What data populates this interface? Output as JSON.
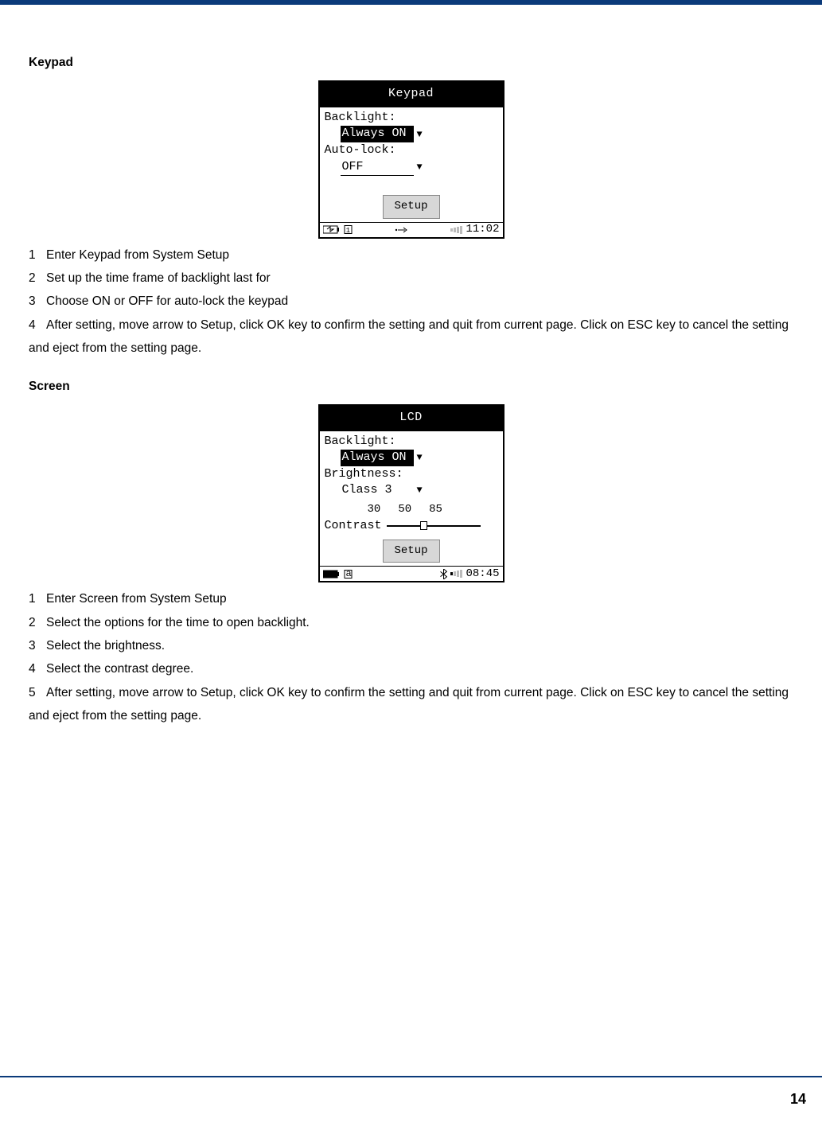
{
  "page": {
    "number": "14"
  },
  "section1": {
    "heading": "Keypad",
    "figure": {
      "title": "Keypad",
      "backlight_label": "Backlight:",
      "backlight_value": "Always ON",
      "autolock_label": "Auto-lock:",
      "autolock_value": "OFF",
      "setup_label": "Setup",
      "status": {
        "time": "11:02"
      }
    },
    "steps": [
      "Enter Keypad from System Setup",
      "Set up the time frame of backlight last for",
      "Choose ON or OFF for auto-lock the keypad",
      "After setting, move arrow to Setup, click OK key to confirm the setting and quit from current page. Click on ESC key to cancel the setting and eject from the setting page."
    ],
    "step_nums": [
      "1",
      "2",
      "3",
      "4"
    ]
  },
  "section2": {
    "heading": "Screen",
    "figure": {
      "title": "LCD",
      "backlight_label": "Backlight:",
      "backlight_value": "Always ON",
      "brightness_label": "Brightness:",
      "brightness_value": "Class 3",
      "ticks": {
        "a": "30",
        "b": "50",
        "c": "85"
      },
      "contrast_label": "Contrast",
      "setup_label": "Setup",
      "status": {
        "time": "08:45",
        "mode": "a"
      }
    },
    "steps": [
      "Enter Screen from System Setup",
      "Select the options for the time to open backlight.",
      "Select the brightness.",
      "Select the contrast degree.",
      "After setting, move arrow to Setup, click OK key to confirm the setting and quit from current page. Click on ESC key to cancel the setting and eject from the setting page."
    ],
    "step_nums": [
      "1",
      "2",
      "3",
      "4",
      "5"
    ]
  }
}
